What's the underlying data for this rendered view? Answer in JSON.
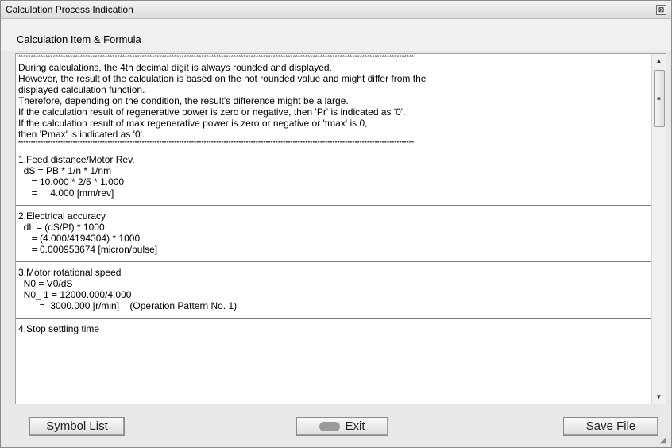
{
  "window": {
    "title": "Calculation Process Indication",
    "close_glyph": "⊠"
  },
  "header": {
    "section_label": "Calculation Item & Formula"
  },
  "notes": {
    "stars_top": "****************************************************************************************************************************************************************",
    "lines": [
      "During calculations, the 4th decimal digit is always rounded and displayed.",
      "However, the result of the calculation is based on the not rounded value and might differ from the",
      "displayed calculation function.",
      "Therefore, depending on the condition, the result's difference might be a large.",
      "If the calculation result of regenerative power is zero or negative, then 'Pr' is indicated as '0'.",
      "If the calculation result of max regenerative power is zero or negative or 'tmax' is 0,",
      "then 'Pmax' is indicated as '0'."
    ],
    "stars_bottom": "****************************************************************************************************************************************************************"
  },
  "sections": [
    {
      "title": "1.Feed distance/Motor Rev.",
      "lines": [
        "  dS = PB * 1/n * 1/nm",
        "     = 10.000 * 2/5 * 1.000",
        "     =     4.000 [mm/rev]"
      ]
    },
    {
      "title": "2.Electrical accuracy",
      "lines": [
        "  dL = (dS/Pf) * 1000",
        "     = (4.000/4194304) * 1000",
        "     = 0.000953674 [micron/pulse]"
      ]
    },
    {
      "title": "3.Motor rotational speed",
      "lines": [
        "  N0 = V0/dS",
        "  N0_ 1 = 12000.000/4.000",
        "        =  3000.000 [r/min]    (Operation Pattern No. 1)"
      ]
    },
    {
      "title": "4.Stop settling time",
      "lines": []
    }
  ],
  "scrollbar": {
    "up_glyph": "▲",
    "down_glyph": "▼",
    "grip_glyph": "≡"
  },
  "buttons": {
    "symbol_list": "Symbol List",
    "exit": "Exit",
    "save_file": "Save File"
  }
}
